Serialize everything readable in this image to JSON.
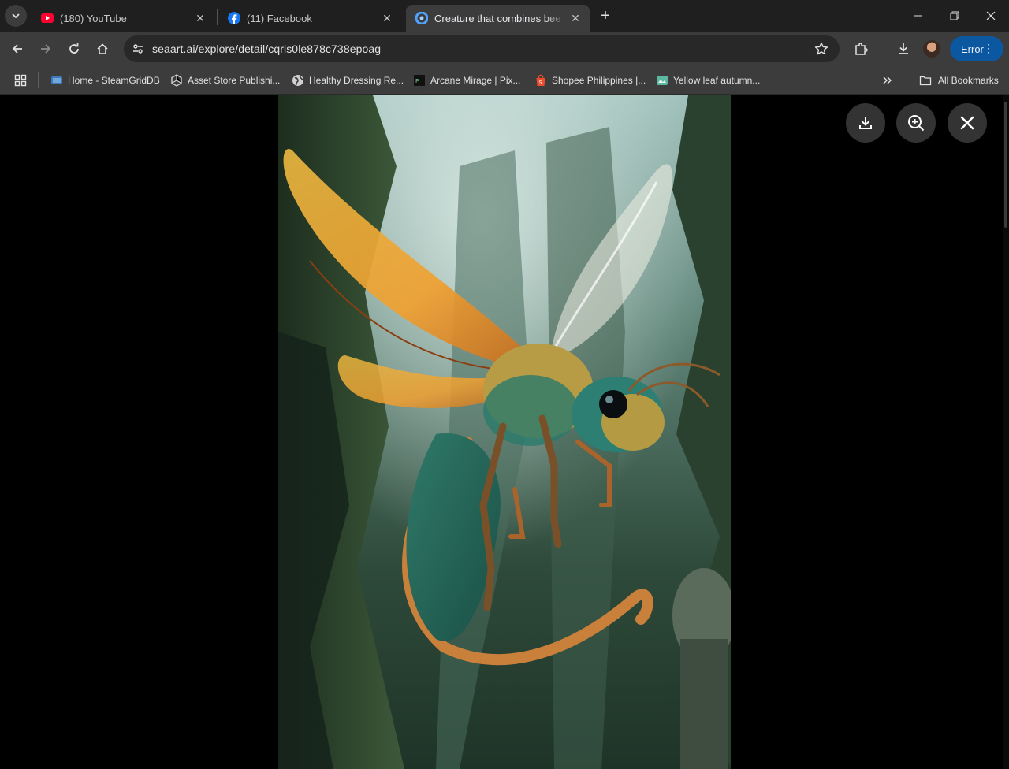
{
  "tabs": [
    {
      "title": "(180) YouTube",
      "icon": "youtube-icon"
    },
    {
      "title": "(11) Facebook",
      "icon": "facebook-icon"
    },
    {
      "title": "Creature that combines bee and",
      "icon": "seaart-icon",
      "active": true
    }
  ],
  "toolbar": {
    "url": "seaart.ai/explore/detail/cqris0le878c738epoag",
    "profile_button": "Error"
  },
  "bookmarks": [
    {
      "label": "Home - SteamGridDB",
      "icon": "steamgriddb-icon"
    },
    {
      "label": "Asset Store Publishi...",
      "icon": "unity-icon"
    },
    {
      "label": "Healthy Dressing Re...",
      "icon": "globe-icon"
    },
    {
      "label": "Arcane Mirage | Pix...",
      "icon": "pixiv-icon"
    },
    {
      "label": "Shopee Philippines |...",
      "icon": "shopee-icon"
    },
    {
      "label": "Yellow leaf autumn...",
      "icon": "image-icon"
    }
  ],
  "all_bookmarks": "All Bookmarks",
  "colors": {
    "accent": "#0b57a0",
    "chrome_dark": "#1f1f1f",
    "toolbar": "#3c3c3c"
  }
}
